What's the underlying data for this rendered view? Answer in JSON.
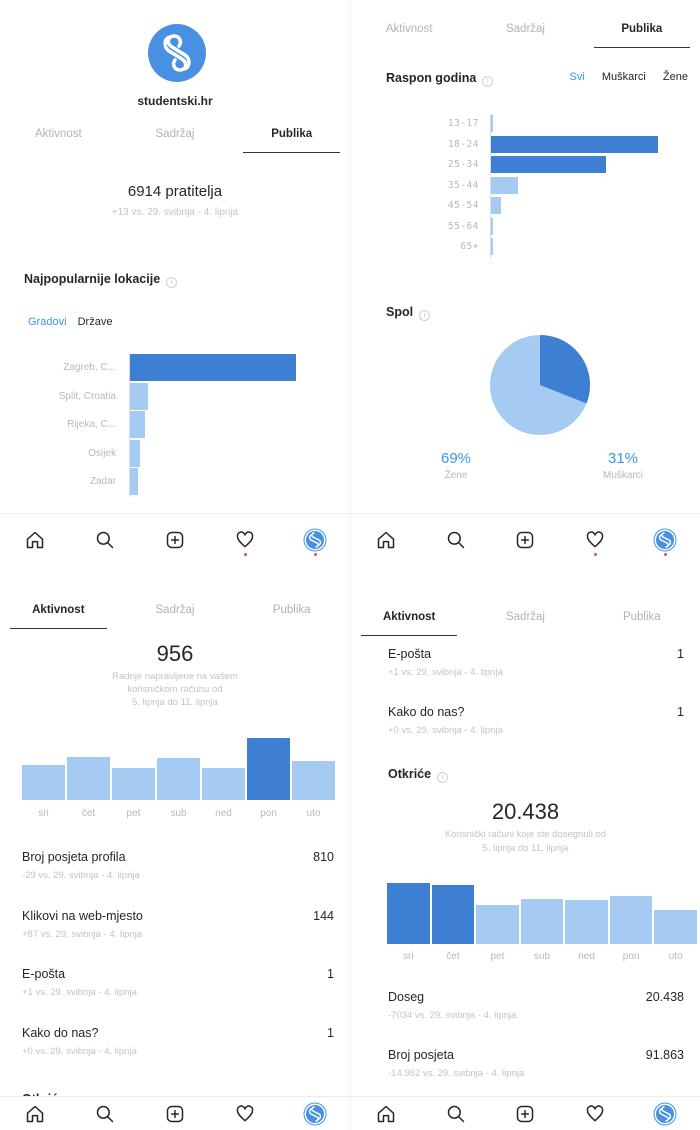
{
  "tabs": {
    "activity": "Aktivnost",
    "content": "Sadržaj",
    "audience": "Publika"
  },
  "colors": {
    "dark_bar": "#3f7fd3",
    "light_bar": "#a5cbf2",
    "mid_bar": "#7fb2ea",
    "accent": "#3897f0"
  },
  "panel1": {
    "username": "studentski.hr",
    "followers": "6914 pratitelja",
    "followers_sub": "+13 vs. 29. svibnja - 4. lipnja",
    "locations_title": "Najpopularnije lokacije",
    "filter_cities": "Gradovi",
    "filter_countries": "Države",
    "locations": [
      {
        "label": "Zagreb, C...",
        "value": 100
      },
      {
        "label": "Split, Croatia",
        "value": 11
      },
      {
        "label": "Rijeka, C...",
        "value": 9
      },
      {
        "label": "Osijek",
        "value": 6
      },
      {
        "label": "Zadar",
        "value": 5
      }
    ]
  },
  "panel2": {
    "age_title": "Raspon godina",
    "filter_all": "Svi",
    "filter_men": "Muškarci",
    "filter_women": "Žene",
    "age_groups": [
      {
        "label": "13-17",
        "value": 0
      },
      {
        "label": "18-24",
        "value": 100
      },
      {
        "label": "25-34",
        "value": 69
      },
      {
        "label": "35-44",
        "value": 16
      },
      {
        "label": "45-54",
        "value": 6
      },
      {
        "label": "55-64",
        "value": 1
      },
      {
        "label": "65+",
        "value": 1
      }
    ],
    "gender_title": "Spol",
    "women_pct": "69%",
    "women_label": "Žene",
    "men_pct": "31%",
    "men_label": "Muškarci",
    "women_value": 69,
    "men_value": 31
  },
  "panel3": {
    "total": "956",
    "total_sub1": "Radnje napravljene na vašem",
    "total_sub2": "korisničkom računu od",
    "total_sub3": "5. lipnja do 11. lipnja",
    "days": [
      {
        "label": "sri",
        "value": 56
      },
      {
        "label": "čet",
        "value": 70
      },
      {
        "label": "pet",
        "value": 52
      },
      {
        "label": "sub",
        "value": 68
      },
      {
        "label": "ned",
        "value": 52
      },
      {
        "label": "pon",
        "value": 100
      },
      {
        "label": "uto",
        "value": 63
      }
    ],
    "highlight_day": "pon",
    "metrics": [
      {
        "label": "Broj posjeta profila",
        "value": "810",
        "sub": "-29 vs. 29. svibnja - 4. lipnja"
      },
      {
        "label": "Klikovi na web-mjesto",
        "value": "144",
        "sub": "+87 vs. 29. svibnja - 4. lipnja"
      },
      {
        "label": "E-pošta",
        "value": "1",
        "sub": "+1 vs. 29. svibnja - 4. lipnja"
      },
      {
        "label": "Kako do nas?",
        "value": "1",
        "sub": "+0 vs. 29. svibnja - 4. lipnja"
      }
    ]
  },
  "panel4": {
    "metrics_top": [
      {
        "label": "E-pošta",
        "value": "1",
        "sub": "+1 vs. 29. svibnja - 4. lipnja"
      },
      {
        "label": "Kako do nas?",
        "value": "1",
        "sub": "+0 vs. 29. svibnja - 4. lipnja"
      }
    ],
    "discovery_title": "Otkriće",
    "total": "20.438",
    "total_sub1": "Korisnički računi koje ste dosegnuli od",
    "total_sub2": "5. lipnja do 11. lipnja",
    "days": [
      {
        "label": "sri",
        "value": 100
      },
      {
        "label": "čet",
        "value": 97
      },
      {
        "label": "pet",
        "value": 64
      },
      {
        "label": "sub",
        "value": 74
      },
      {
        "label": "ned",
        "value": 72
      },
      {
        "label": "pon",
        "value": 78
      },
      {
        "label": "uto",
        "value": 56
      }
    ],
    "metrics_bottom": [
      {
        "label": "Doseg",
        "value": "20.438",
        "sub": "-7034 vs. 29. svibnja - 4. lipnja"
      },
      {
        "label": "Broj posjeta",
        "value": "91.863",
        "sub": "-14.982 vs. 29. svibnja - 4. lipnja"
      }
    ]
  }
}
